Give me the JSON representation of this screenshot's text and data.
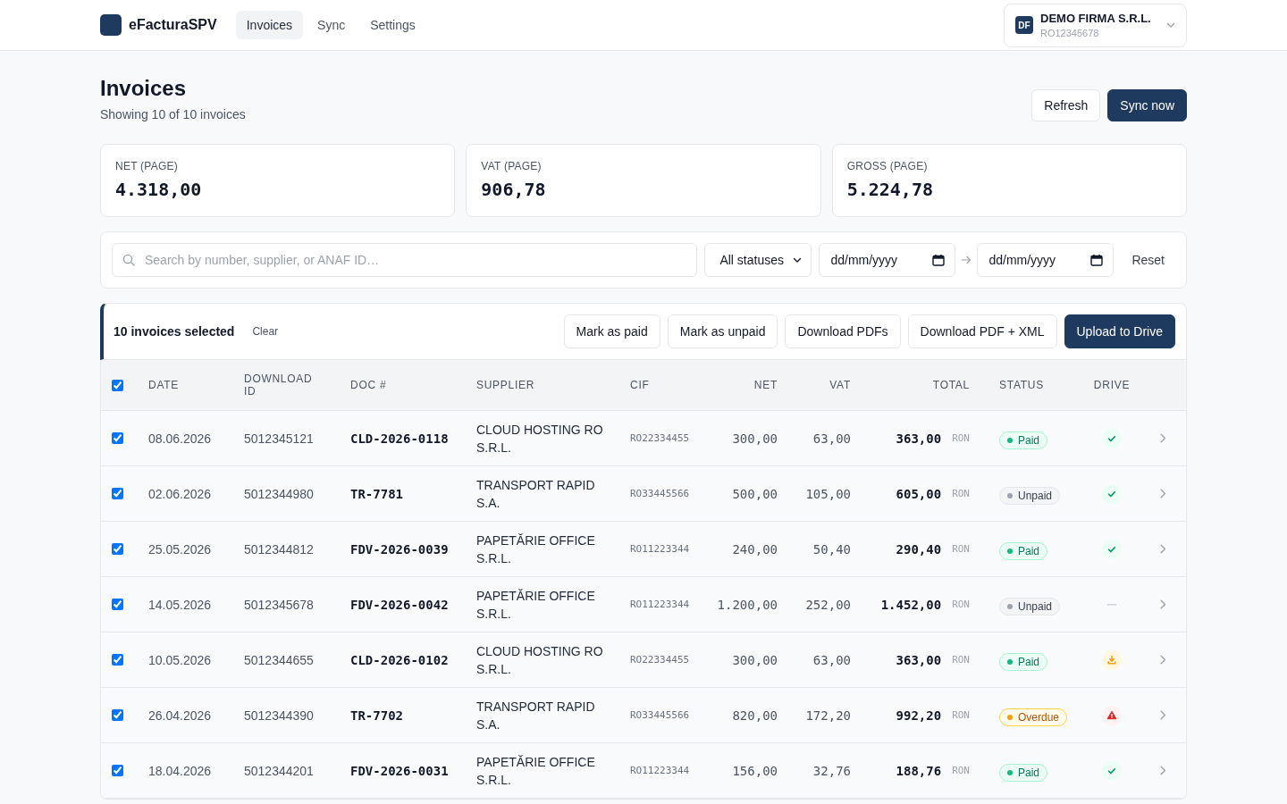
{
  "nav": {
    "brand": "eFacturaSPV",
    "tabs": [
      {
        "label": "Invoices",
        "selected": true
      },
      {
        "label": "Sync",
        "selected": false
      },
      {
        "label": "Settings",
        "selected": false
      }
    ],
    "company": {
      "initials": "DF",
      "name": "DEMO FIRMA S.R.L.",
      "cif": "RO12345678"
    }
  },
  "page": {
    "title": "Invoices",
    "subtitle": "Showing 10 of 10 invoices",
    "actions": [
      {
        "label": "Refresh",
        "kind": "secondary"
      },
      {
        "label": "Sync now",
        "kind": "primary"
      }
    ]
  },
  "stats": [
    {
      "label": "NET (PAGE)",
      "value": "4.318,00"
    },
    {
      "label": "VAT (PAGE)",
      "value": "906,78"
    },
    {
      "label": "GROSS (PAGE)",
      "value": "5.224,78"
    }
  ],
  "filters": {
    "search": {
      "placeholder": "Search by number, supplier, or ANAF ID…"
    },
    "status": {
      "value": "All statuses"
    },
    "date_from": {
      "placeholder": "dd/mm/yyyy"
    },
    "date_to": {
      "placeholder": "dd/mm/yyyy"
    },
    "reset": "Reset"
  },
  "bulk": {
    "label": "10 invoices selected",
    "clear": "Clear",
    "actions": [
      {
        "label": "Mark as paid",
        "kind": "secondary"
      },
      {
        "label": "Mark as unpaid",
        "kind": "secondary"
      },
      {
        "label": "Download PDFs",
        "kind": "secondary"
      },
      {
        "label": "Download PDF + XML",
        "kind": "secondary"
      },
      {
        "label": "Upload to Drive",
        "kind": "primary"
      }
    ]
  },
  "table": {
    "select_all": true,
    "columns": [
      "DATE",
      "DOWNLOAD ID",
      "DOC #",
      "SUPPLIER",
      "CIF",
      "NET",
      "VAT",
      "TOTAL",
      "STATUS",
      "DRIVE"
    ],
    "rows": [
      {
        "selected": true,
        "date": "08.06.2026",
        "download_id": "5012345121",
        "doc": "CLD-2026-0118",
        "supplier": "CLOUD HOSTING RO S.R.L.",
        "cif": "RO22334455",
        "net": "300,00",
        "vat": "63,00",
        "total": "363,00",
        "currency": "RON",
        "status": {
          "label": "Paid",
          "kind": "paid"
        },
        "drive": {
          "kind": "uploaded"
        }
      },
      {
        "selected": true,
        "date": "02.06.2026",
        "download_id": "5012344980",
        "doc": "TR-7781",
        "supplier": "TRANSPORT RAPID S.A.",
        "cif": "RO33445566",
        "net": "500,00",
        "vat": "105,00",
        "total": "605,00",
        "currency": "RON",
        "status": {
          "label": "Unpaid",
          "kind": "unpaid"
        },
        "drive": {
          "kind": "uploaded"
        }
      },
      {
        "selected": true,
        "date": "25.05.2026",
        "download_id": "5012344812",
        "doc": "FDV-2026-0039",
        "supplier": "PAPETĂRIE OFFICE S.R.L.",
        "cif": "RO11223344",
        "net": "240,00",
        "vat": "50,40",
        "total": "290,40",
        "currency": "RON",
        "status": {
          "label": "Paid",
          "kind": "paid"
        },
        "drive": {
          "kind": "uploaded"
        }
      },
      {
        "selected": true,
        "date": "14.05.2026",
        "download_id": "5012345678",
        "doc": "FDV-2026-0042",
        "supplier": "PAPETĂRIE OFFICE S.R.L.",
        "cif": "RO11223344",
        "net": "1.200,00",
        "vat": "252,00",
        "total": "1.452,00",
        "currency": "RON",
        "status": {
          "label": "Unpaid",
          "kind": "unpaid"
        },
        "drive": {
          "kind": "none"
        }
      },
      {
        "selected": true,
        "date": "10.05.2026",
        "download_id": "5012344655",
        "doc": "CLD-2026-0102",
        "supplier": "CLOUD HOSTING RO S.R.L.",
        "cif": "RO22334455",
        "net": "300,00",
        "vat": "63,00",
        "total": "363,00",
        "currency": "RON",
        "status": {
          "label": "Paid",
          "kind": "paid"
        },
        "drive": {
          "kind": "pending"
        }
      },
      {
        "selected": true,
        "date": "26.04.2026",
        "download_id": "5012344390",
        "doc": "TR-7702",
        "supplier": "TRANSPORT RAPID S.A.",
        "cif": "RO33445566",
        "net": "820,00",
        "vat": "172,20",
        "total": "992,20",
        "currency": "RON",
        "status": {
          "label": "Overdue",
          "kind": "overdue"
        },
        "drive": {
          "kind": "failed"
        }
      },
      {
        "selected": true,
        "date": "18.04.2026",
        "download_id": "5012344201",
        "doc": "FDV-2026-0031",
        "supplier": "PAPETĂRIE OFFICE S.R.L.",
        "cif": "RO11223344",
        "net": "156,00",
        "vat": "32,76",
        "total": "188,76",
        "currency": "RON",
        "status": {
          "label": "Paid",
          "kind": "paid"
        },
        "drive": {
          "kind": "uploaded"
        }
      }
    ]
  }
}
